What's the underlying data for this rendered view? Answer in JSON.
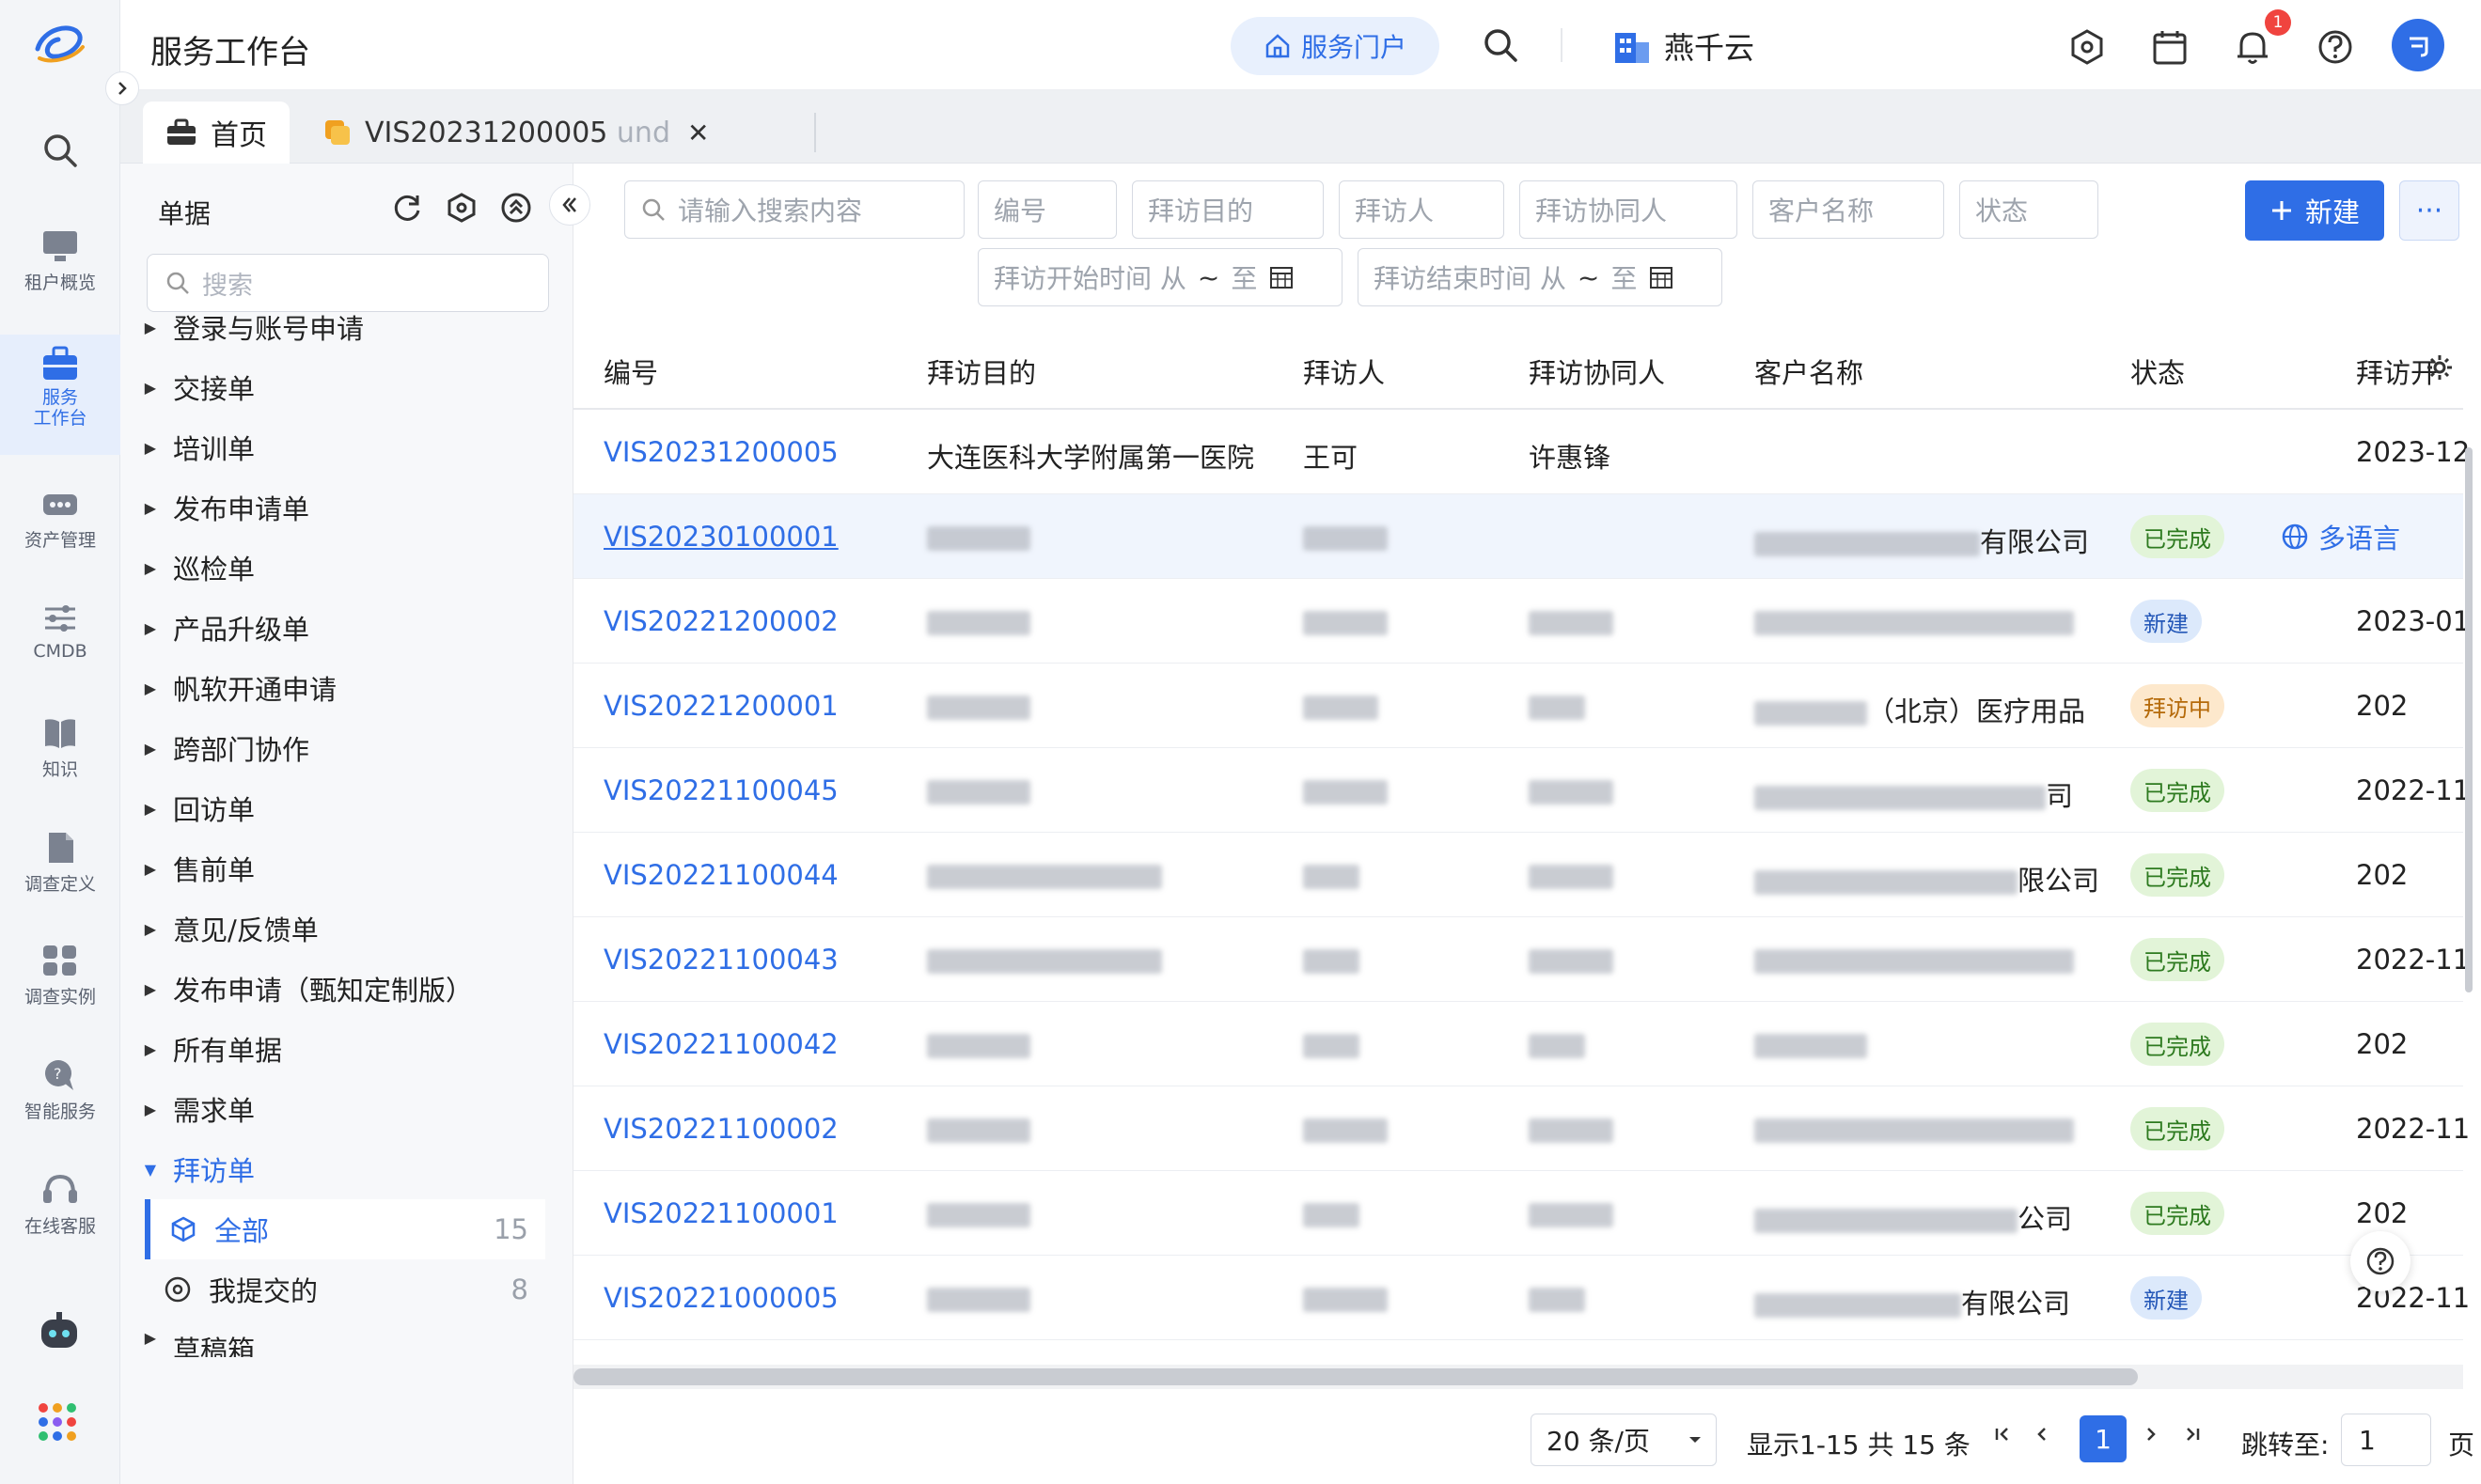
{
  "app": {
    "title": "服务工作台"
  },
  "topbar": {
    "portal_label": "服务门户",
    "org_name": "燕千云",
    "notification_count": "1"
  },
  "leftnav": [
    {
      "label": "租户概览",
      "icon": "monitor-icon"
    },
    {
      "label": "服务\n工作台",
      "icon": "briefcase-icon"
    },
    {
      "label": "资产管理",
      "icon": "asset-icon"
    },
    {
      "label": "CMDB",
      "icon": "sliders-icon"
    },
    {
      "label": "知识",
      "icon": "book-icon"
    },
    {
      "label": "调查定义",
      "icon": "document-icon"
    },
    {
      "label": "调查实例",
      "icon": "grid-icon"
    },
    {
      "label": "智能服务",
      "icon": "chat-bubble-icon"
    },
    {
      "label": "在线客服",
      "icon": "headset-icon"
    }
  ],
  "tabs": {
    "home": "首页",
    "record_id": "VIS20231200005",
    "record_suffix": "und"
  },
  "tree": {
    "title": "单据",
    "search_placeholder": "搜索",
    "nodes": [
      "登录与账号申请",
      "交接单",
      "培训单",
      "发布申请单",
      "巡检单",
      "产品升级单",
      "帆软开通申请",
      "跨部门协作",
      "回访单",
      "售前单",
      "意见/反馈单",
      "发布申请（甄知定制版）",
      "所有单据",
      "需求单"
    ],
    "expanded": "拜访单",
    "children": [
      {
        "label": "全部",
        "count": "15"
      },
      {
        "label": "我提交的",
        "count": "8"
      }
    ],
    "partial": "草稿箱"
  },
  "filters": {
    "search_placeholder": "请输入搜索内容",
    "code": "编号",
    "purpose": "拜访目的",
    "visitor": "拜访人",
    "co_visitor": "拜访协同人",
    "customer": "客户名称",
    "status": "状态",
    "start_from": "拜访开始时间 从",
    "end_from": "拜访结束时间 从",
    "tilde": "~",
    "to": "至",
    "new_label": "新建",
    "more_label": "···"
  },
  "table": {
    "headers": [
      "编号",
      "拜访目的",
      "拜访人",
      "拜访协同人",
      "客户名称",
      "状态",
      "拜访开"
    ],
    "rows": [
      {
        "code": "VIS20231200005",
        "purpose": "大连医科大学附属第一医院",
        "visitor": "王可",
        "co": "许惠锋",
        "customer": "",
        "status": "",
        "status_type": "",
        "date": "2023-12"
      },
      {
        "code": "VIS20230100001",
        "purpose": "",
        "visitor": "",
        "co": "",
        "customer": "有限公司",
        "status": "已完成",
        "status_type": "done",
        "date": "",
        "extra": "多语言"
      },
      {
        "code": "VIS20221200002",
        "purpose": "",
        "visitor": "",
        "co": "",
        "customer": "",
        "status": "新建",
        "status_type": "new",
        "date": "2023-01"
      },
      {
        "code": "VIS20221200001",
        "purpose": "",
        "visitor": "",
        "co": "",
        "customer": "（北京）医疗用品",
        "status": "拜访中",
        "status_type": "visiting",
        "date": "202"
      },
      {
        "code": "VIS20221100045",
        "purpose": "",
        "visitor": "",
        "co": "",
        "customer": "司",
        "status": "已完成",
        "status_type": "done",
        "date": "2022-11"
      },
      {
        "code": "VIS20221100044",
        "purpose": "",
        "visitor": "",
        "co": "",
        "customer": "限公司",
        "status": "已完成",
        "status_type": "done",
        "date": "202"
      },
      {
        "code": "VIS20221100043",
        "purpose": "",
        "visitor": "",
        "co": "",
        "customer": "",
        "status": "已完成",
        "status_type": "done",
        "date": "2022-11"
      },
      {
        "code": "VIS20221100042",
        "purpose": "",
        "visitor": "",
        "co": "",
        "customer": "",
        "status": "已完成",
        "status_type": "done",
        "date": "202"
      },
      {
        "code": "VIS20221100002",
        "purpose": "",
        "visitor": "",
        "co": "",
        "customer": "",
        "status": "已完成",
        "status_type": "done",
        "date": "2022-11"
      },
      {
        "code": "VIS20221100001",
        "purpose": "",
        "visitor": "",
        "co": "",
        "customer": "公司",
        "status": "已完成",
        "status_type": "done",
        "date": "202"
      },
      {
        "code": "VIS20221000005",
        "purpose": "",
        "visitor": "",
        "co": "",
        "customer": "有限公司",
        "status": "新建",
        "status_type": "new",
        "date": "2022-11"
      }
    ]
  },
  "pagination": {
    "page_size": "20 条/页",
    "summary": "显示1-15 共 15 条",
    "current_page": "1",
    "jump_label": "跳转至:",
    "jump_value": "1",
    "page_unit": "页"
  },
  "colors": {
    "accent": "#2f6ee6",
    "done": "#e2f4d8",
    "new": "#dce9fb",
    "visiting": "#fde8cc"
  }
}
